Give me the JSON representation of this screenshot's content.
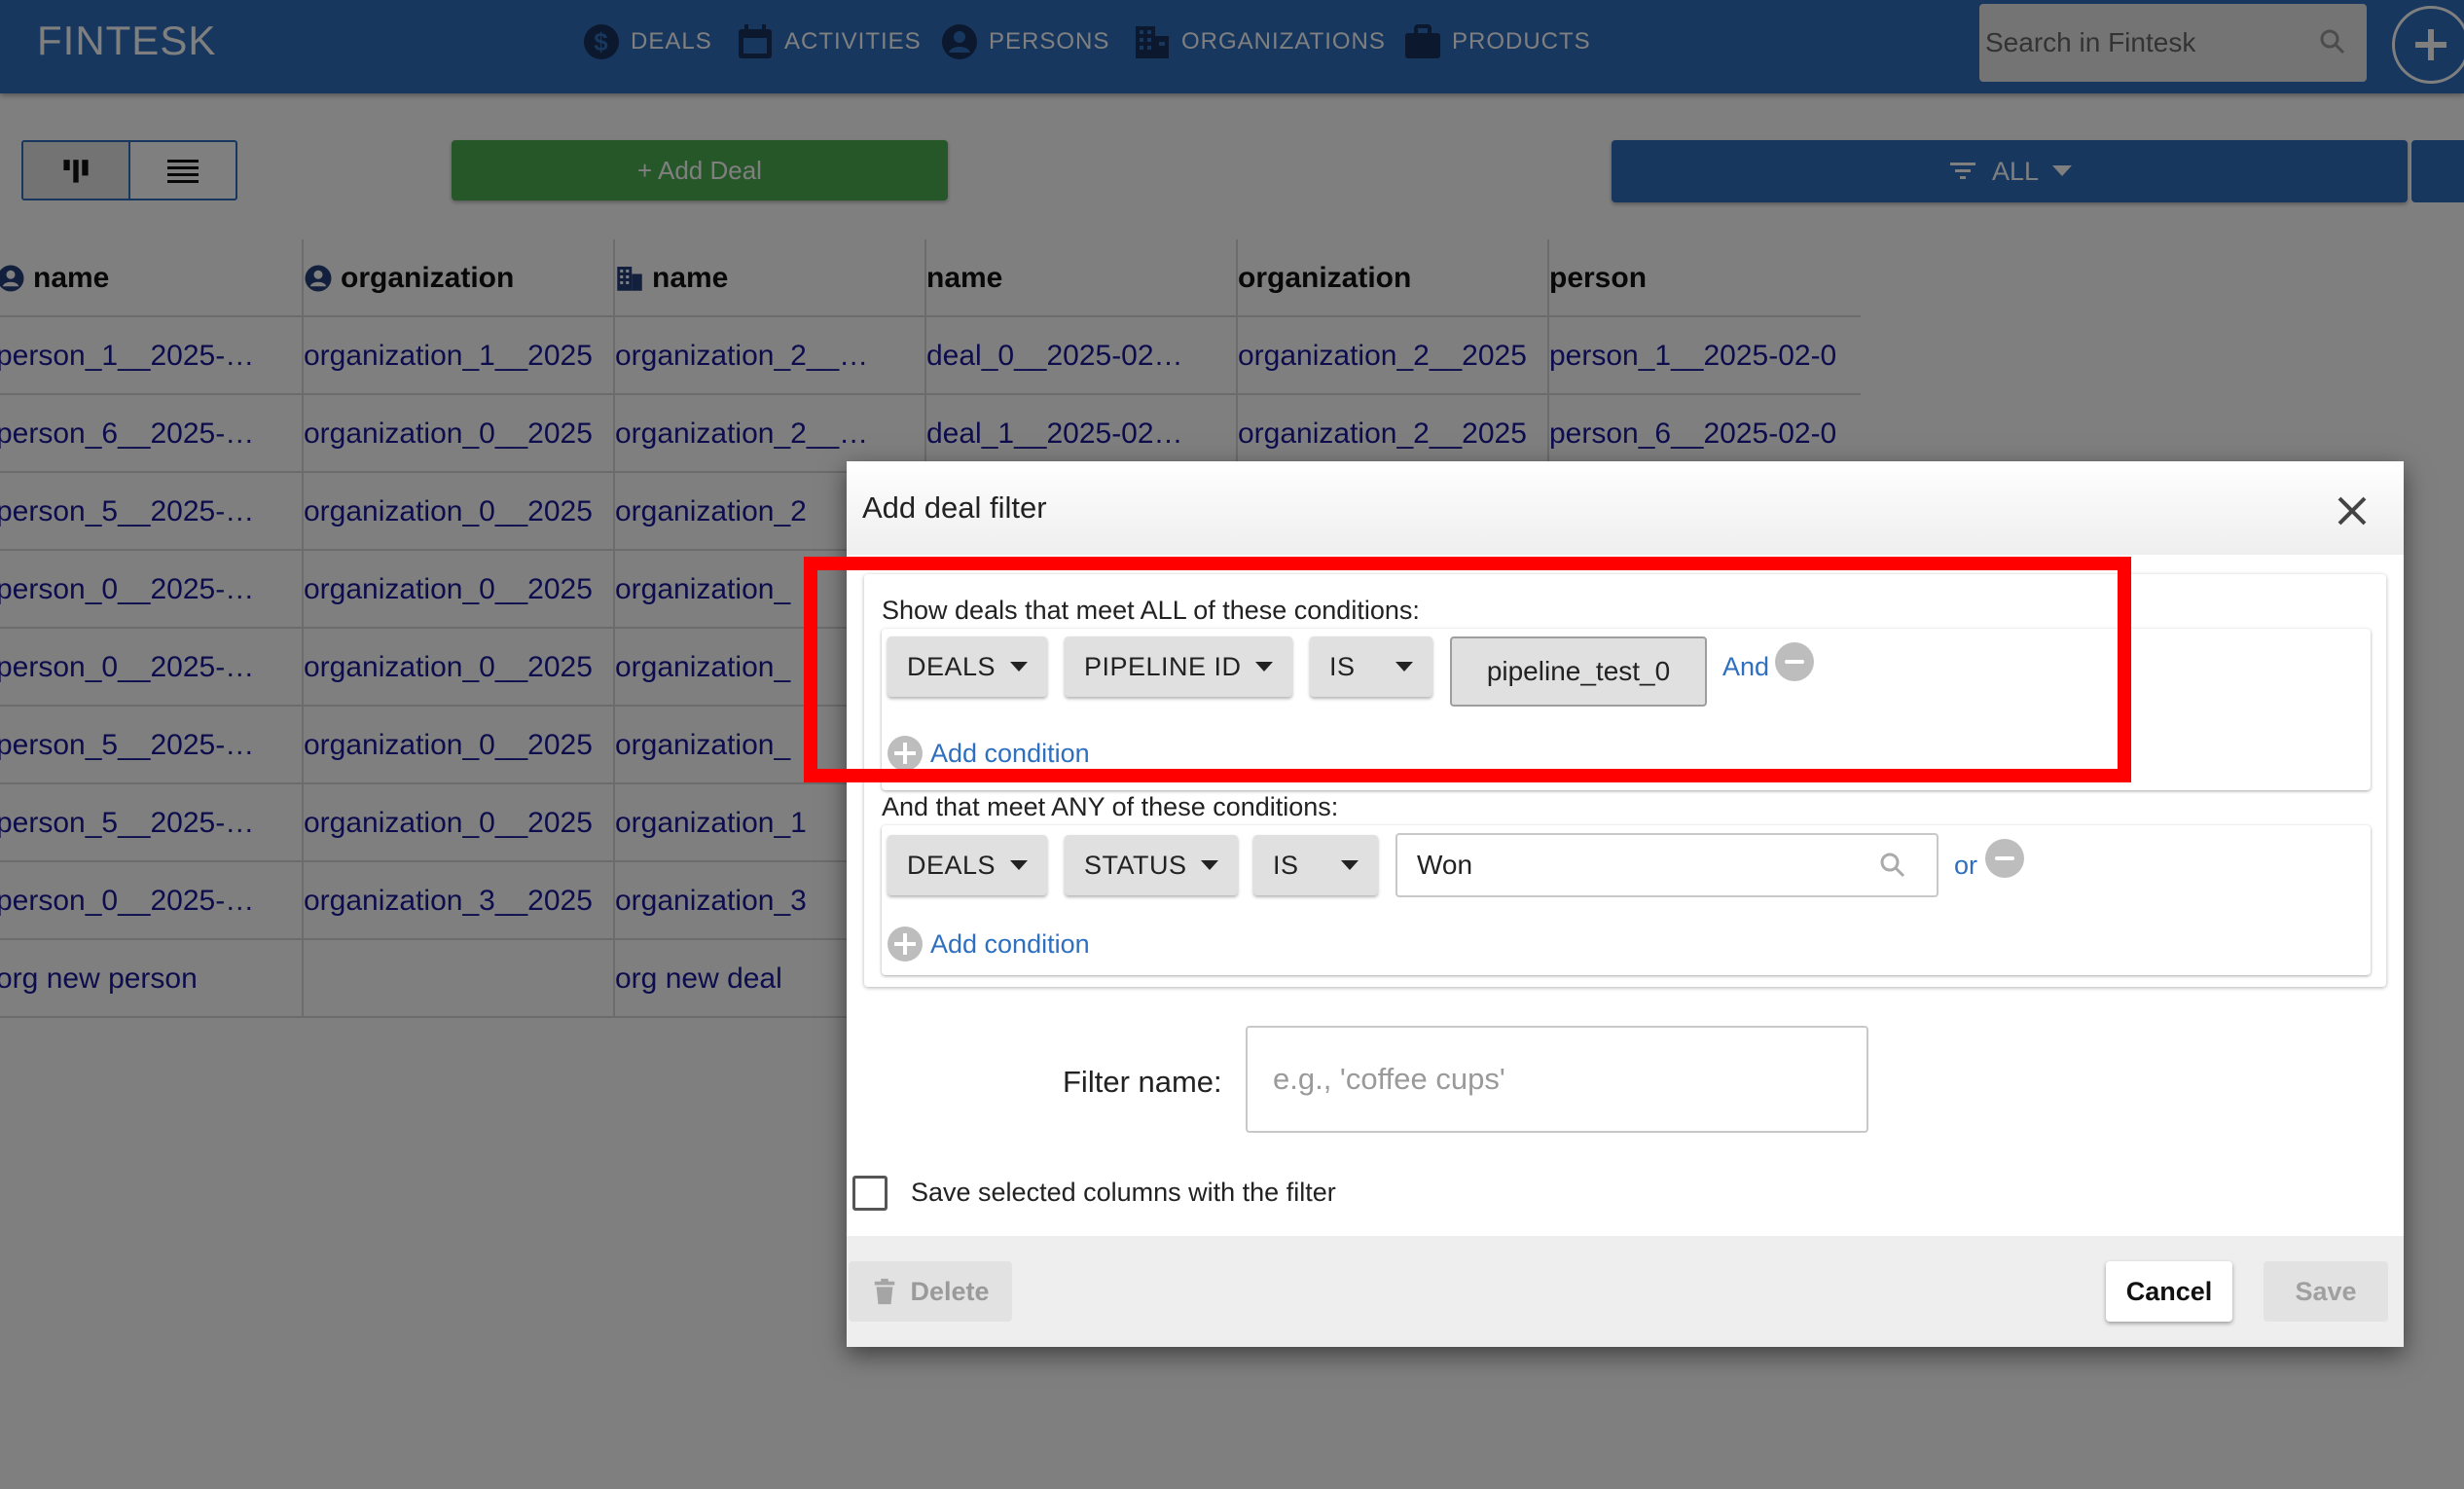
{
  "app": {
    "brand": "FINTESK",
    "nav": [
      {
        "label": "DEALS",
        "icon": "dollar-icon"
      },
      {
        "label": "ACTIVITIES",
        "icon": "calendar-icon"
      },
      {
        "label": "PERSONS",
        "icon": "person-icon"
      },
      {
        "label": "ORGANIZATIONS",
        "icon": "building-icon"
      },
      {
        "label": "PRODUCTS",
        "icon": "briefcase-icon"
      }
    ],
    "search": {
      "placeholder": "Search in Fintesk"
    }
  },
  "toolbar": {
    "add_deal_label": "+ Add Deal",
    "filter_label": "ALL"
  },
  "table": {
    "headers": [
      "name",
      "organization",
      "name",
      "name",
      "organization",
      "person"
    ],
    "header_icons": [
      "person-icon",
      "person-icon",
      "building-icon",
      "",
      "",
      ""
    ],
    "rows": [
      [
        "person_1__2025-…",
        "organization_1__2025",
        "organization_2__…",
        "deal_0__2025-02…",
        "organization_2__2025",
        "person_1__2025-02-0"
      ],
      [
        "person_6__2025-…",
        "organization_0__2025",
        "organization_2__…",
        "deal_1__2025-02…",
        "organization_2__2025",
        "person_6__2025-02-0"
      ],
      [
        "person_5__2025-…",
        "organization_0__2025",
        "organization_2",
        "",
        "",
        ""
      ],
      [
        "person_0__2025-…",
        "organization_0__2025",
        "organization_",
        "",
        "",
        ""
      ],
      [
        "person_0__2025-…",
        "organization_0__2025",
        "organization_",
        "",
        "",
        ""
      ],
      [
        "person_5__2025-…",
        "organization_0__2025",
        "organization_",
        "",
        "",
        ""
      ],
      [
        "person_5__2025-…",
        "organization_0__2025",
        "organization_1",
        "",
        "",
        ""
      ],
      [
        "person_0__2025-…",
        "organization_3__2025",
        "organization_3",
        "",
        "",
        ""
      ],
      [
        "org new person",
        "",
        "org new deal",
        "",
        "",
        ""
      ]
    ]
  },
  "dialog": {
    "title": "Add deal filter",
    "all_section": {
      "label": "Show deals that meet ALL of these conditions:",
      "condition": {
        "entity": "DEALS",
        "field": "PIPELINE ID",
        "operator": "IS",
        "value": "pipeline_test_0"
      },
      "connector": "And",
      "add_condition": "Add condition"
    },
    "any_section": {
      "label": "And that meet ANY of these conditions:",
      "condition": {
        "entity": "DEALS",
        "field": "STATUS",
        "operator": "IS",
        "value": "Won"
      },
      "connector": "or",
      "add_condition": "Add condition"
    },
    "filter_name_label": "Filter name:",
    "filter_name_placeholder": "e.g., 'coffee cups'",
    "filter_name_value": "",
    "save_columns_label": "Save selected columns with the filter",
    "save_columns_checked": false,
    "buttons": {
      "delete": "Delete",
      "cancel": "Cancel",
      "save": "Save"
    }
  },
  "colors": {
    "nav_blue": "#2f6fbf",
    "add_green": "#4caf50",
    "highlight_red": "#ff0000",
    "link_blue": "#2f6fbf"
  }
}
